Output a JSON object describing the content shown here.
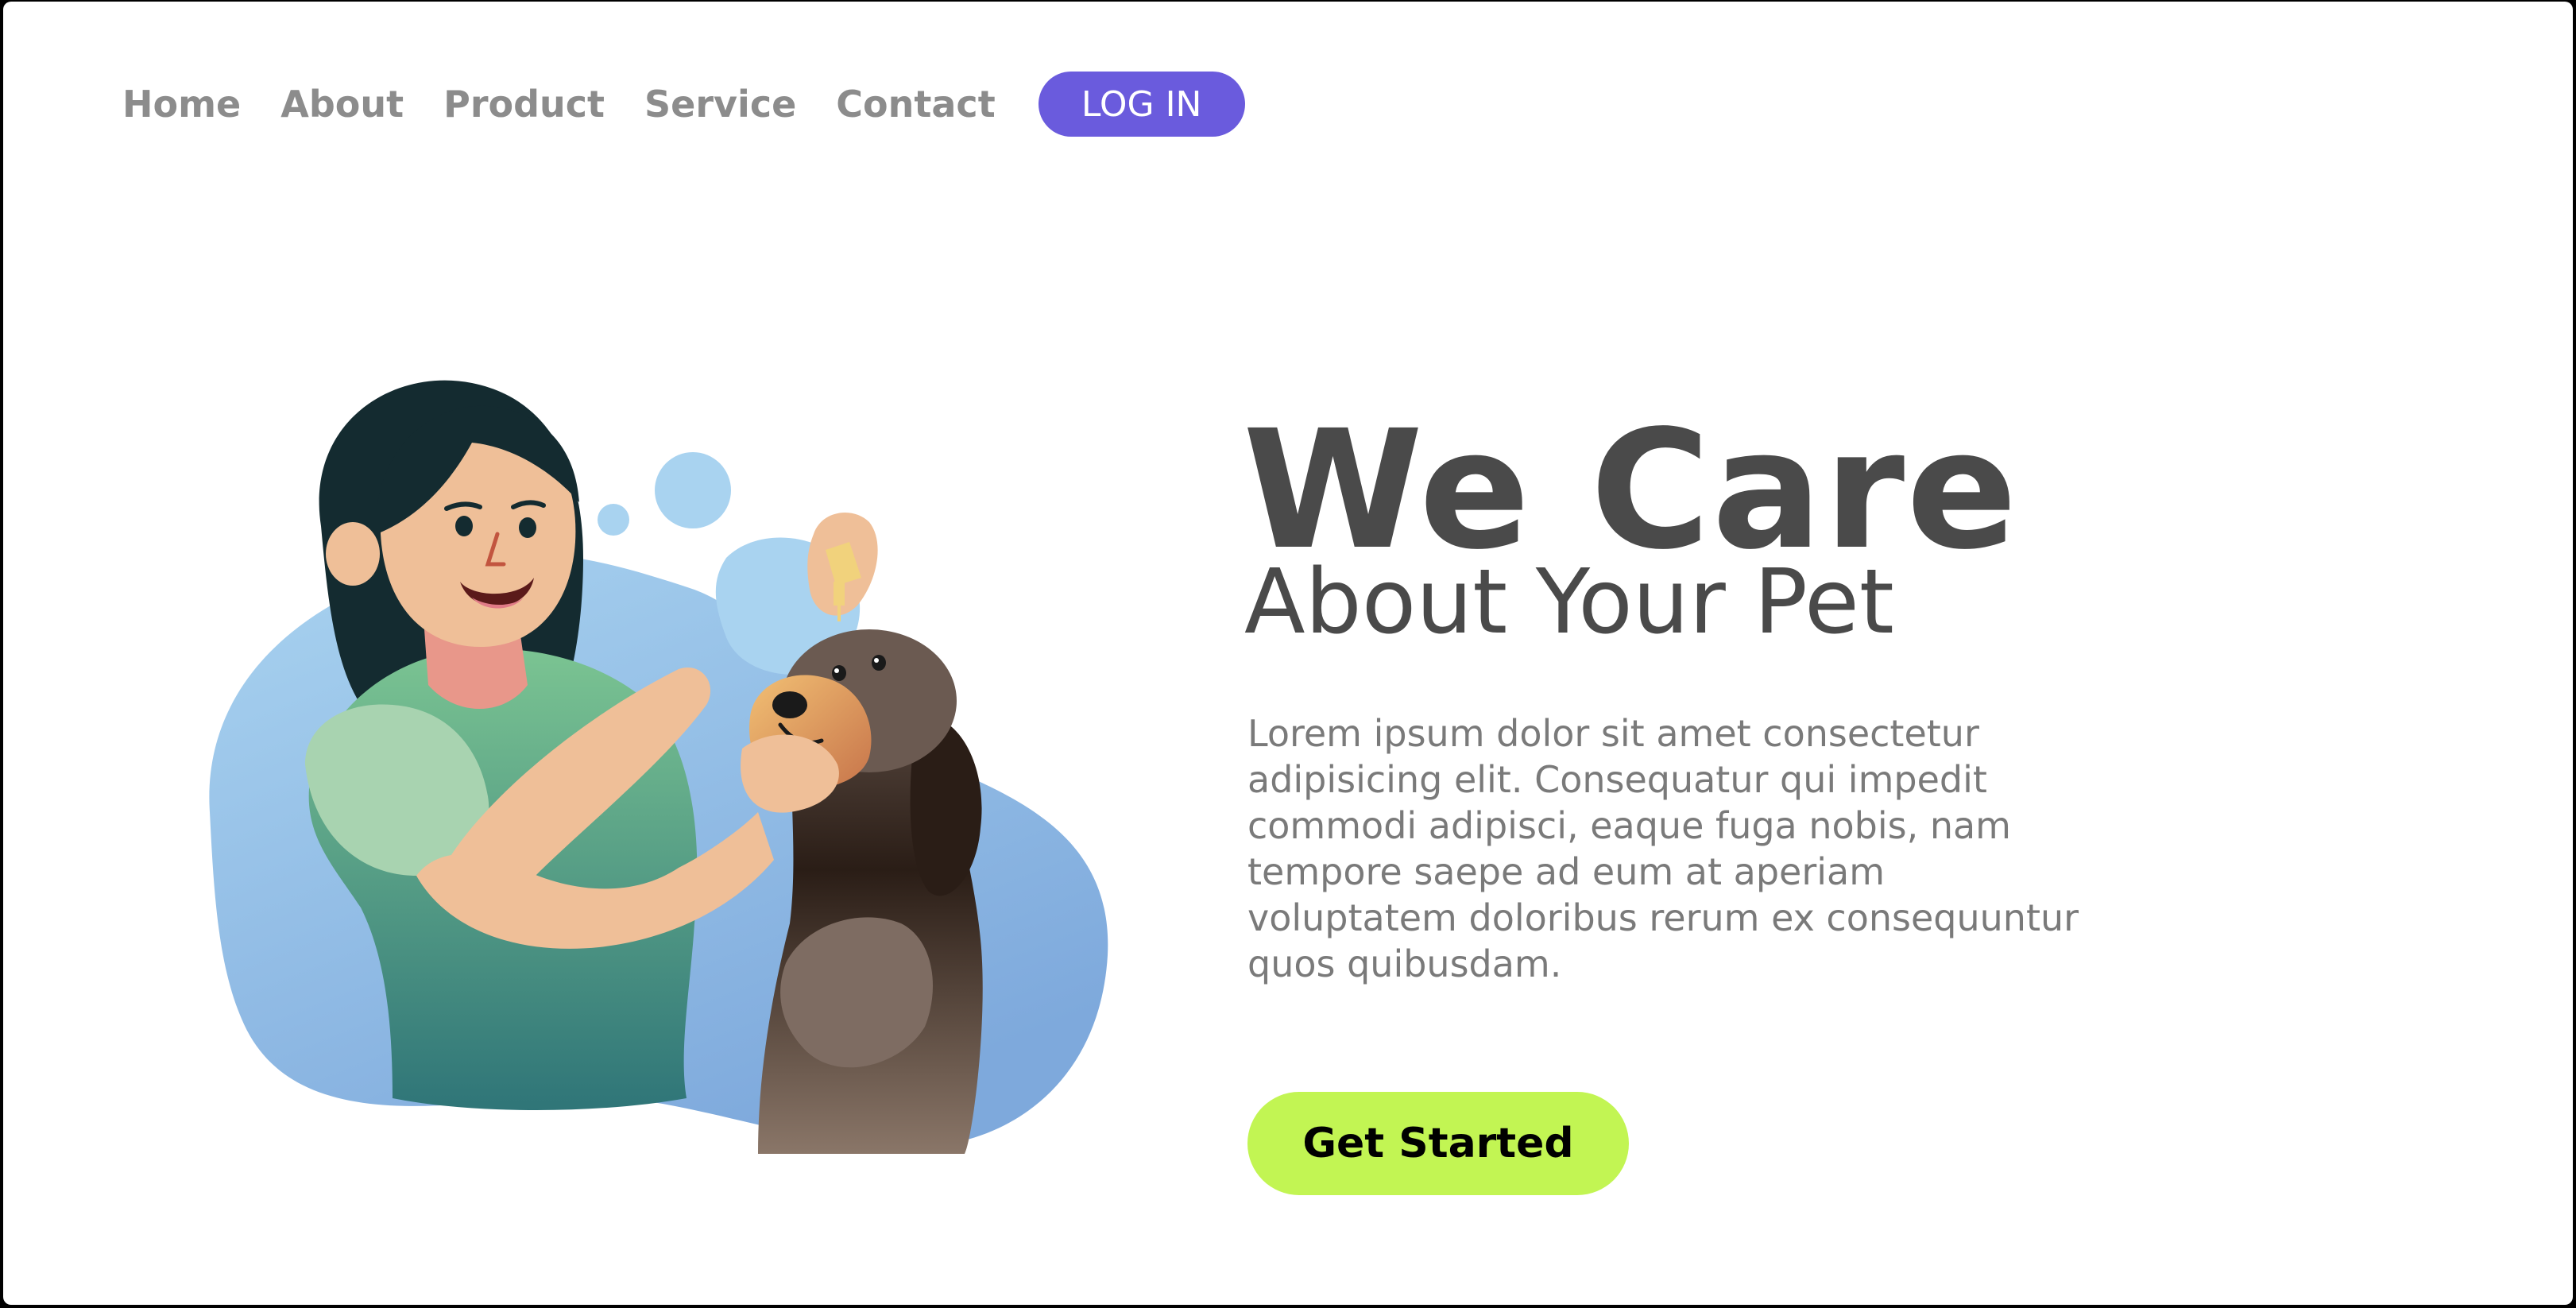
{
  "nav": {
    "items": [
      {
        "label": "Home"
      },
      {
        "label": "About"
      },
      {
        "label": "Product"
      },
      {
        "label": "Service"
      },
      {
        "label": "Contact"
      }
    ],
    "login_label": "LOG IN"
  },
  "hero": {
    "title": "We Care",
    "subtitle": "About Your Pet",
    "body": "Lorem ipsum dolor sit amet consectetur adipisicing elit. Consequatur qui impedit commodi adipisci, eaque fuga nobis, nam tempore saepe ad eum at aperiam voluptatem doloribus rerum ex consequuntur quos quibusdam.",
    "cta_label": "Get Started"
  },
  "colors": {
    "accent": "#6a5bdd",
    "cta": "#c2f553",
    "heading": "#4a4a4a",
    "nav_text": "#8c8c8c",
    "body_text": "#7a7a7a"
  },
  "illustration": {
    "icon": "woman-giving-dog-eye-drops-illustration"
  }
}
